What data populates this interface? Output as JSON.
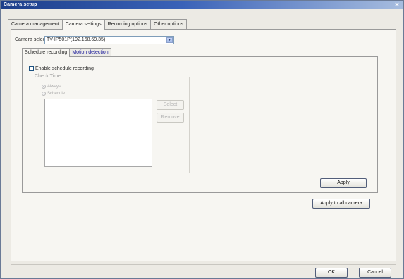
{
  "window": {
    "title": "Camera setup"
  },
  "top_tabs": [
    {
      "label": "Camera management",
      "active": false
    },
    {
      "label": "Camera settings",
      "active": true
    },
    {
      "label": "Recording options",
      "active": false
    },
    {
      "label": "Other options",
      "active": false
    }
  ],
  "camera_select": {
    "label": "Camera select",
    "value": "TV-IP501P(192.168.69.35)"
  },
  "sub_tabs": [
    {
      "label": "Schedule recording",
      "active": true
    },
    {
      "label": "Motion detection",
      "active": false
    }
  ],
  "schedule": {
    "enable_label": "Enable schedule recording",
    "enable_checked": false,
    "check_time_label": "Check Time",
    "radio_always": "Always",
    "radio_schedule": "Schedule",
    "select_button": "Select",
    "remove_button": "Remove",
    "apply_button": "Apply"
  },
  "apply_all_button": "Apply to all camera",
  "dialog": {
    "ok_button": "OK",
    "cancel_button": "Cancel"
  },
  "colors": {
    "title_bar": "#1d3f8a",
    "panel": "#f7f6f2",
    "window_bg": "#eceae4"
  }
}
